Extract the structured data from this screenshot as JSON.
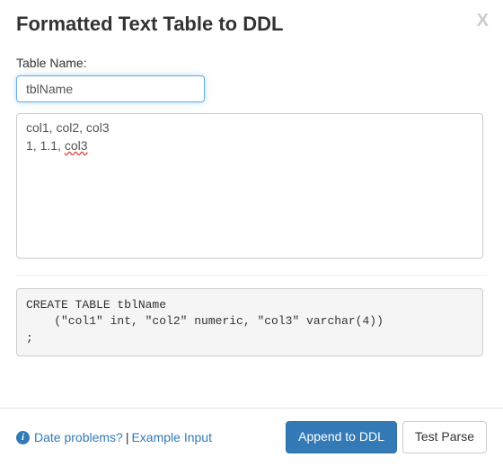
{
  "header": {
    "title": "Formatted Text Table to DDL",
    "close": "X"
  },
  "form": {
    "tableNameLabel": "Table Name:",
    "tableNameValue": "tblName",
    "dataTextLine1": "col1, col2, col3",
    "dataTextLine2Prefix": "1, 1.1, ",
    "dataTextLine2Squiggly": "col3",
    "ddlOutput": "CREATE TABLE tblName\n    (\"col1\" int, \"col2\" numeric, \"col3\" varchar(4))\n;"
  },
  "footer": {
    "dateProblemsLabel": "Date problems?",
    "sep": "|",
    "exampleInputLabel": "Example Input",
    "appendLabel": "Append to DDL",
    "testParseLabel": "Test Parse"
  }
}
